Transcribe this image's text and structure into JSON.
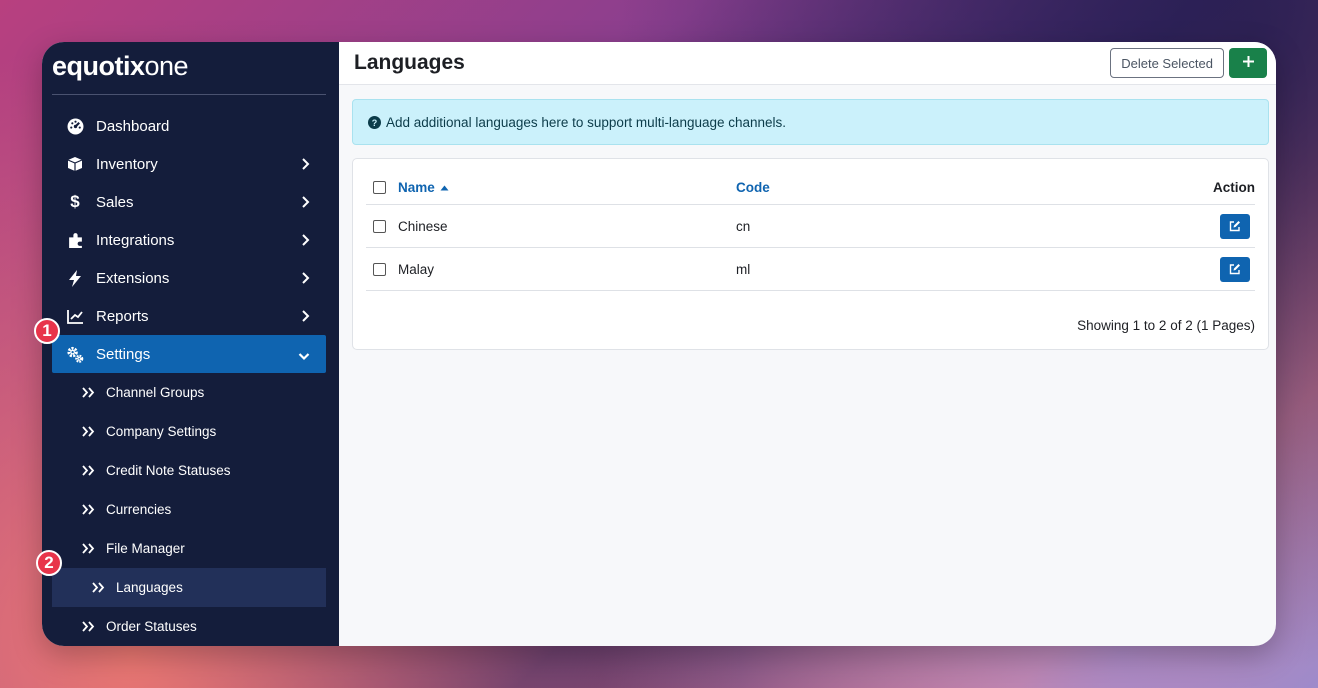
{
  "app": {
    "logo_main": "equotix",
    "logo_suffix": "one"
  },
  "sidebar": {
    "items": [
      {
        "label": "Dashboard",
        "icon": "dashboard-icon"
      },
      {
        "label": "Inventory",
        "icon": "box-icon"
      },
      {
        "label": "Sales",
        "icon": "dollar-icon"
      },
      {
        "label": "Integrations",
        "icon": "puzzle-icon"
      },
      {
        "label": "Extensions",
        "icon": "bolt-icon"
      },
      {
        "label": "Reports",
        "icon": "chart-line-icon"
      },
      {
        "label": "Settings",
        "icon": "gears-icon"
      }
    ],
    "settings_sub": [
      {
        "label": "Channel Groups"
      },
      {
        "label": "Company Settings"
      },
      {
        "label": "Credit Note Statuses"
      },
      {
        "label": "Currencies"
      },
      {
        "label": "File Manager"
      },
      {
        "label": "Languages"
      },
      {
        "label": "Order Statuses"
      }
    ]
  },
  "badges": {
    "one": "1",
    "two": "2"
  },
  "header": {
    "title": "Languages",
    "delete_label": "Delete Selected"
  },
  "alert": {
    "text": "Add additional languages here to support multi-language channels."
  },
  "table": {
    "columns": {
      "name": "Name",
      "code": "Code",
      "action": "Action"
    },
    "rows": [
      {
        "name": "Chinese",
        "code": "cn"
      },
      {
        "name": "Malay",
        "code": "ml"
      }
    ],
    "footer": "Showing 1 to 2 of 2 (1 Pages)"
  },
  "colors": {
    "sidebar_bg": "#141d3b",
    "active": "#0f64b0",
    "add_button": "#19814a",
    "badge": "#e8344a",
    "alert_bg": "#cbf1fb"
  }
}
